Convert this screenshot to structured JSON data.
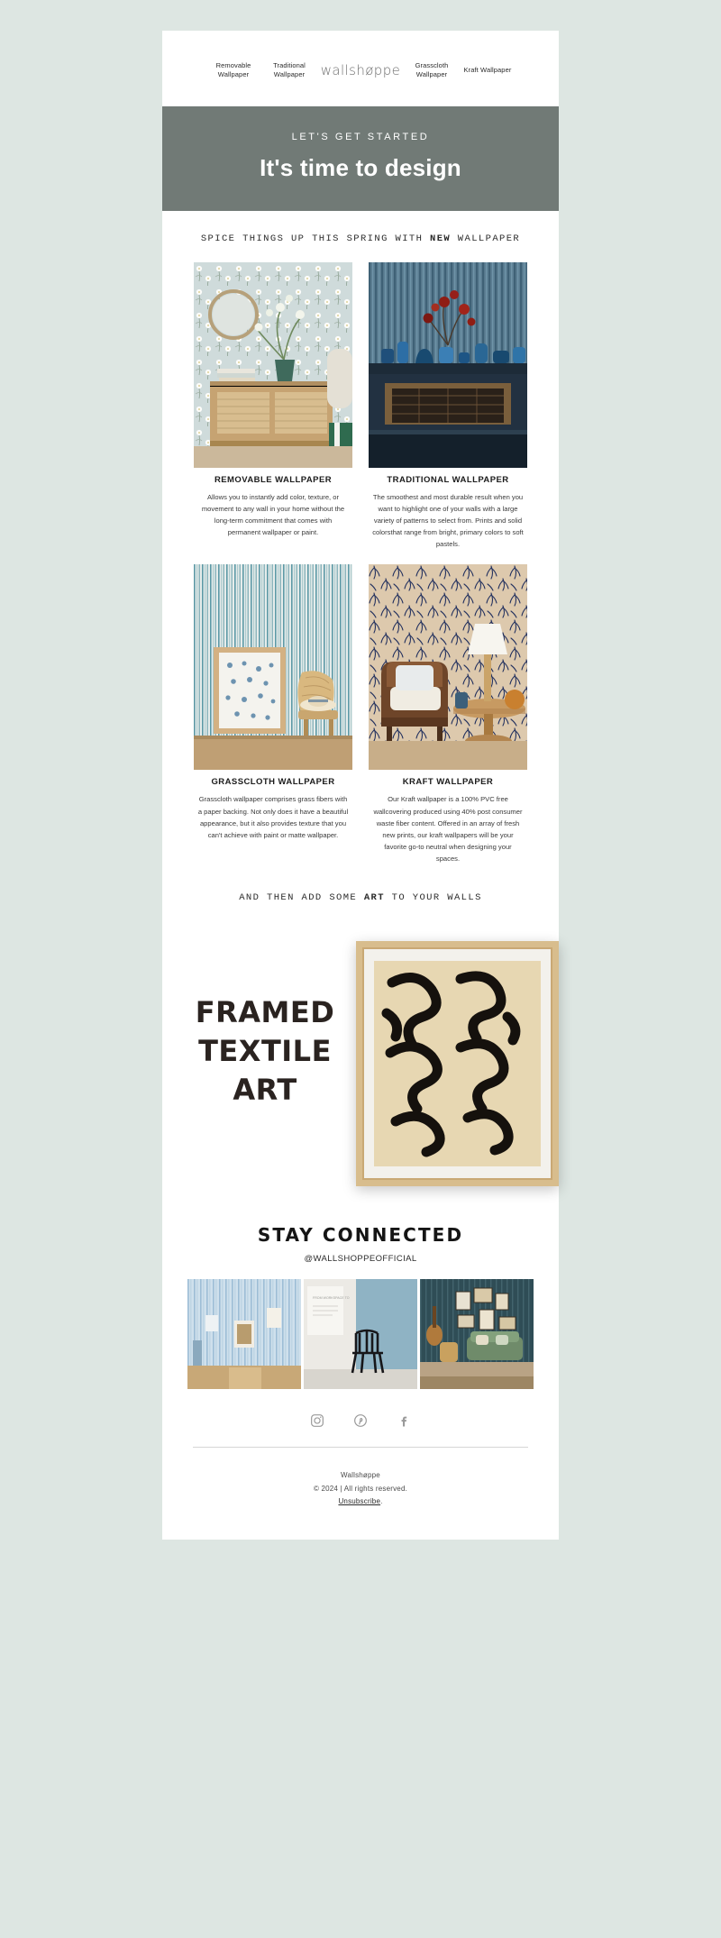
{
  "nav": {
    "items": [
      {
        "label": "Removable Wallpaper"
      },
      {
        "label": "Traditional Wallpaper"
      }
    ],
    "logo": "wallshøppe",
    "items_right": [
      {
        "label": "Grasscloth Wallpaper"
      },
      {
        "label": "Kraft Wallpaper"
      }
    ]
  },
  "hero": {
    "kicker": "LET'S GET STARTED",
    "title": "It's time to design",
    "bg": "#717a76"
  },
  "tagline": {
    "before": "SPICE THINGS UP THIS SPRING WITH ",
    "emphasis": "NEW",
    "after": " WALLPAPER"
  },
  "products": [
    {
      "title": "REMOVABLE WALLPAPER",
      "text": "Allows you to instantly add color, texture, or movement to any wall in your home without the long-term commitment that comes with permanent wallpaper or paint.",
      "image": "removable-wallpaper-room"
    },
    {
      "title": "TRADITIONAL WALLPAPER",
      "text": "The smoothest and most durable result when you want to highlight one of your walls with a large variety of patterns to select from. Prints and solid colorsthat range from bright, primary colors to soft pastels.",
      "image": "traditional-wallpaper-fireplace"
    },
    {
      "title": "GRASSCLOTH WALLPAPER",
      "text": "Grasscloth wallpaper comprises grass fibers with a paper backing. Not only does it have a beautiful appearance, but it also provides texture that you can't achieve with paint or matte wallpaper.",
      "image": "grasscloth-wallpaper-chair"
    },
    {
      "title": "KRAFT WALLPAPER",
      "text": "Our Kraft wallpaper is a 100% PVC free wallcovering produced using 40% post consumer waste fiber content. Offered in an array of fresh new prints, our kraft wallpapers will be your favorite go-to neutral when designing your spaces.",
      "image": "kraft-wallpaper-armchair"
    }
  ],
  "art_tagline": {
    "before": "AND THEN ADD SOME ",
    "emphasis": "ART",
    "after": " TO YOUR WALLS"
  },
  "art": {
    "words": [
      "FRAMED",
      "TEXTILE",
      "ART"
    ],
    "image": "framed-textile-art"
  },
  "connected": {
    "title": "STAY CONNECTED",
    "handle": "@WALLSHOPPEOFFICIAL",
    "tiles": [
      {
        "name": "social-tile-blue-stripe-wall"
      },
      {
        "name": "social-tile-black-chair"
      },
      {
        "name": "social-tile-living-room"
      }
    ],
    "icons": [
      {
        "name": "instagram-icon"
      },
      {
        "name": "pinterest-icon"
      },
      {
        "name": "facebook-icon"
      }
    ]
  },
  "footer": {
    "brand": "Wallshøppe",
    "copyright": "© 2024 | All rights reserved.",
    "unsubscribe": "Unsubscribe",
    "period": "."
  }
}
